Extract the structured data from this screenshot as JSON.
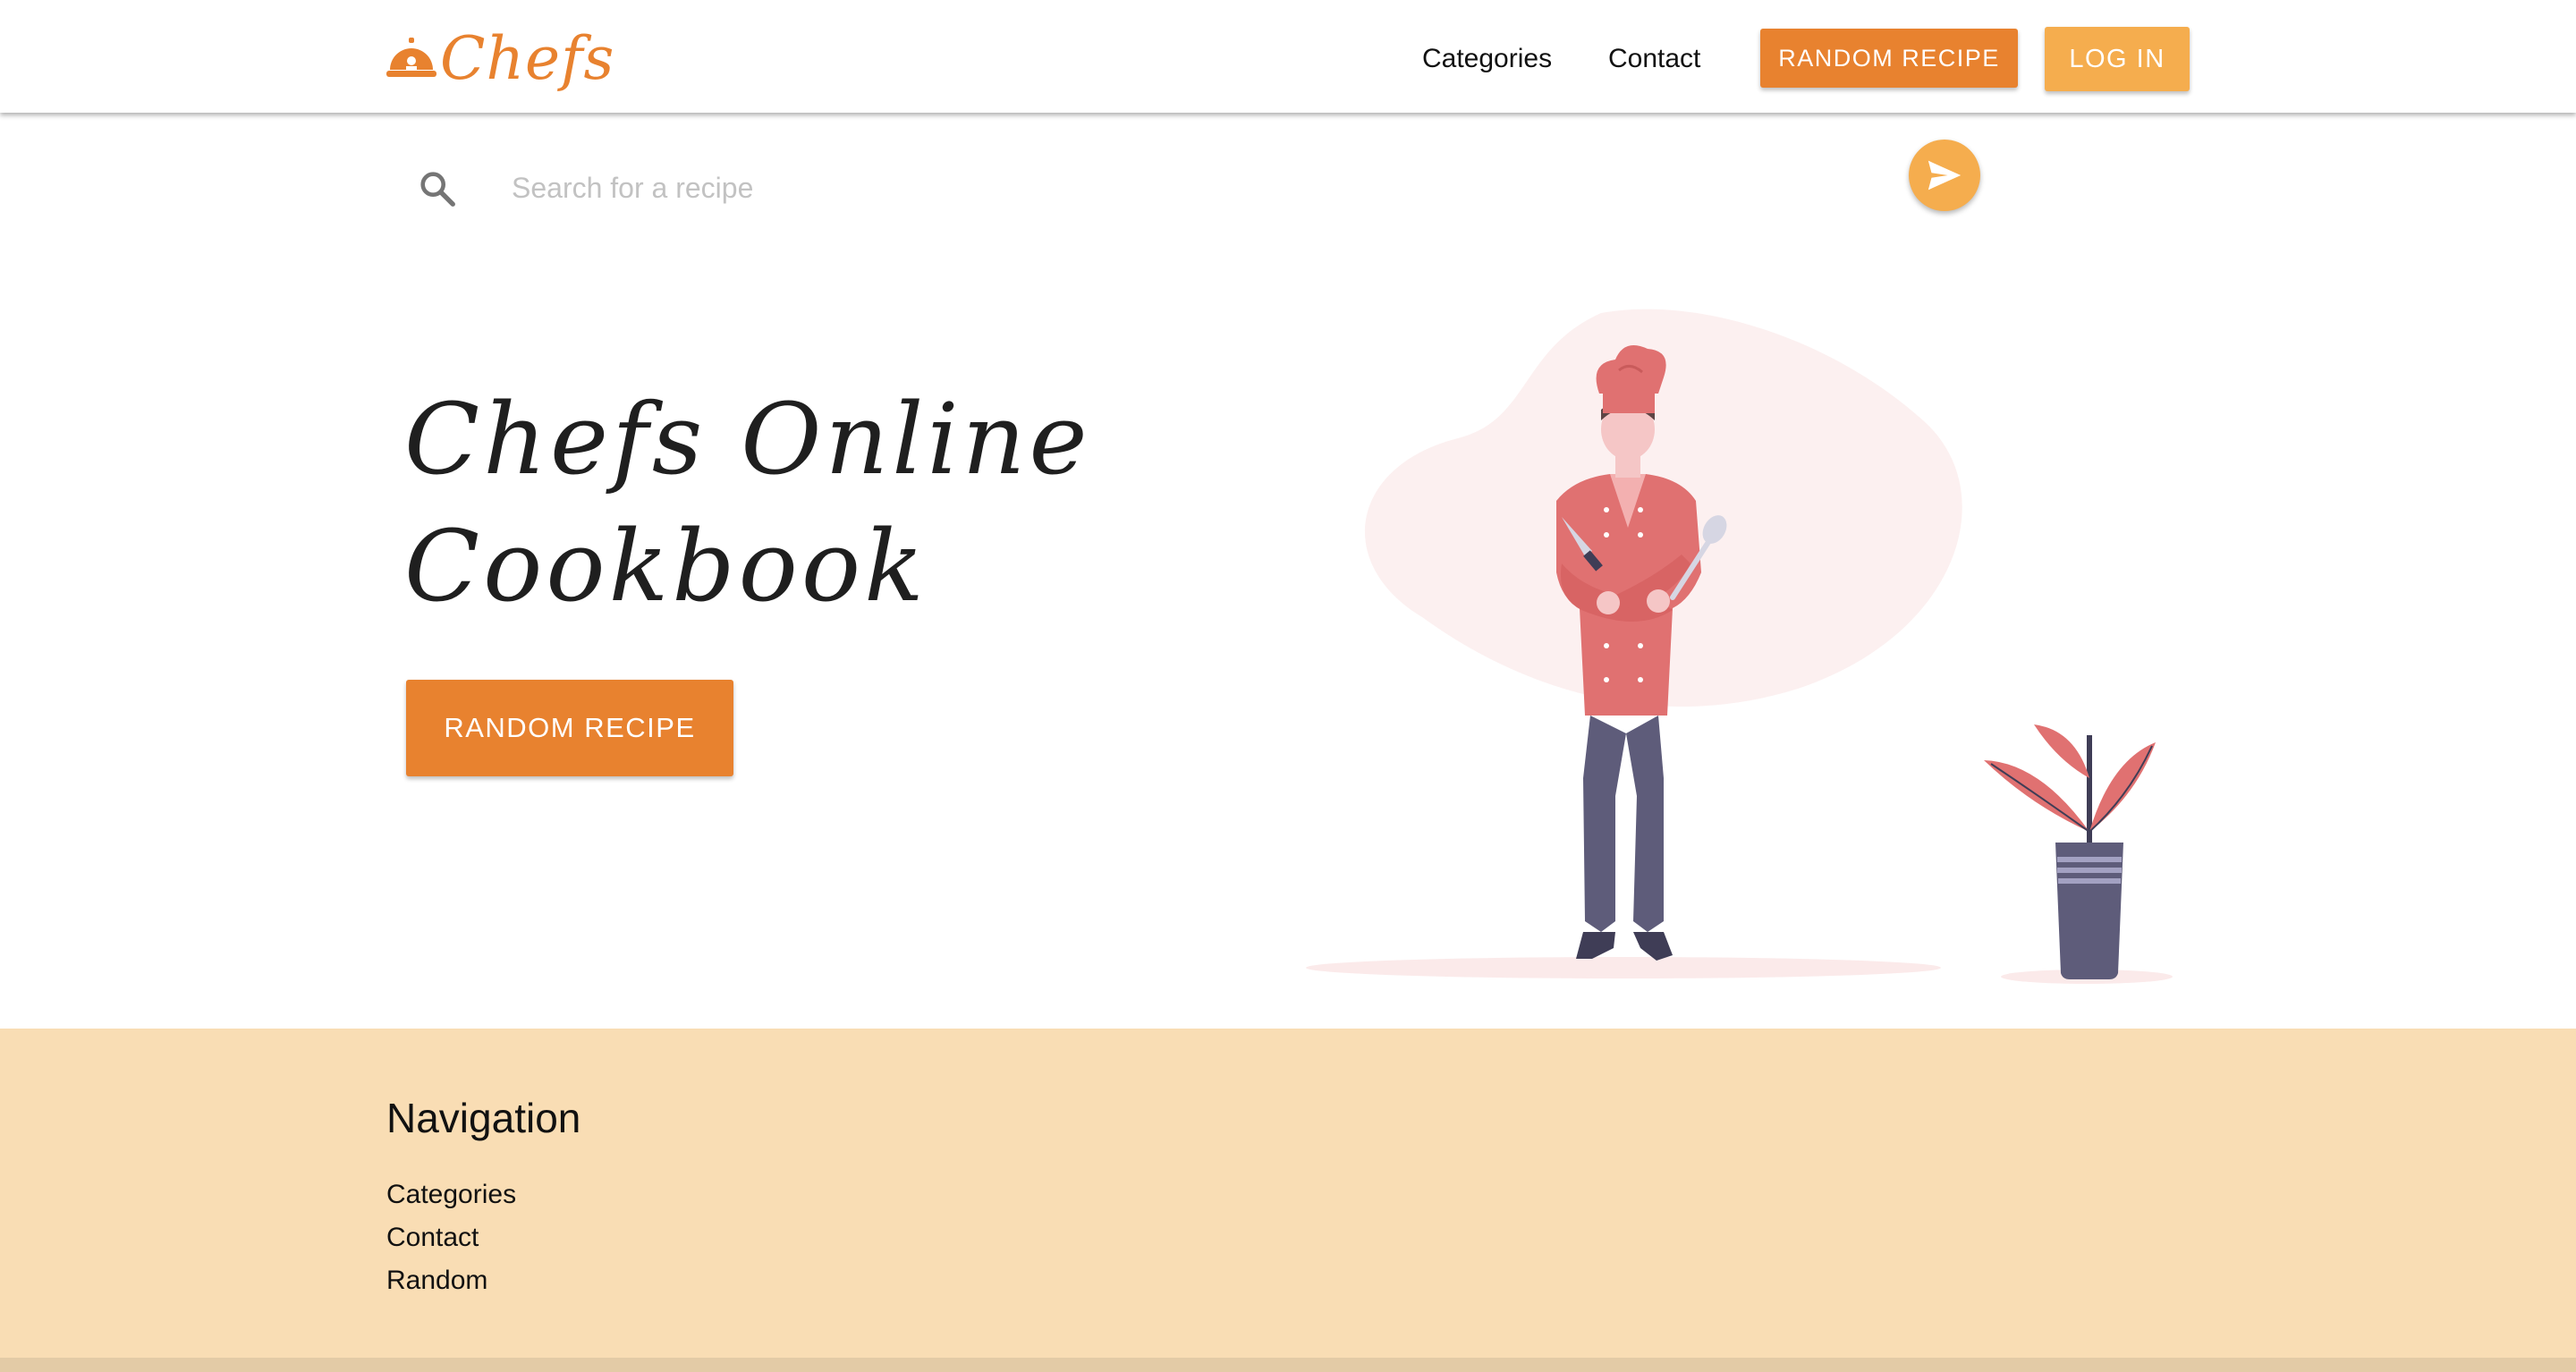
{
  "header": {
    "brand_name": "Chefs",
    "logo_icon": "cloche-icon",
    "nav": {
      "categories": "Categories",
      "contact": "Contact"
    },
    "random_recipe_label": "RANDOM RECIPE",
    "login_label": "LOG IN"
  },
  "search": {
    "placeholder": "Search for a recipe",
    "value": "",
    "search_icon": "search-icon",
    "send_icon": "send-icon"
  },
  "hero": {
    "title_line1": "Chefs Online",
    "title_line2": "Cookbook",
    "random_recipe_label": "RANDOM RECIPE",
    "illustration": "chef-with-knife-and-spoon-and-potted-plant"
  },
  "footer": {
    "heading": "Navigation",
    "links": [
      "Categories",
      "Contact",
      "Random"
    ]
  },
  "colors": {
    "accent_orange": "#e8822f",
    "light_orange": "#f5ad4e",
    "footer_bg": "#f9ddb4",
    "chef_red": "#e07171",
    "pants": "#5e5c7a"
  }
}
